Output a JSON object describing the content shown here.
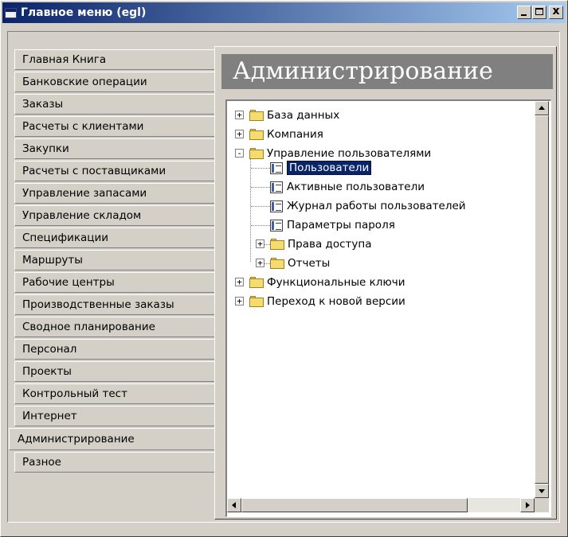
{
  "window": {
    "title": "Главное меню (egl)",
    "close_glyph": "x"
  },
  "tabs": [
    {
      "label": "Главная Книга"
    },
    {
      "label": "Банковские операции"
    },
    {
      "label": "Заказы"
    },
    {
      "label": "Расчеты с клиентами"
    },
    {
      "label": "Закупки"
    },
    {
      "label": "Расчеты с поставщиками"
    },
    {
      "label": "Управление запасами"
    },
    {
      "label": "Управление складом"
    },
    {
      "label": "Спецификации"
    },
    {
      "label": "Маршруты"
    },
    {
      "label": "Рабочие центры"
    },
    {
      "label": "Производственные заказы"
    },
    {
      "label": "Сводное планирование"
    },
    {
      "label": "Персонал"
    },
    {
      "label": "Проекты"
    },
    {
      "label": "Контрольный тест"
    },
    {
      "label": "Интернет"
    },
    {
      "label": "Администрирование",
      "active": true
    },
    {
      "label": "Разное"
    }
  ],
  "main": {
    "heading": "Администрирование"
  },
  "tree": {
    "items": [
      {
        "label": "База данных",
        "icon": "folder-icon",
        "expander": "+"
      },
      {
        "label": "Компания",
        "icon": "folder-icon",
        "expander": "+"
      },
      {
        "label": "Управление пользователями",
        "icon": "folder-icon",
        "expander": "-"
      },
      {
        "label": "Пользователи",
        "icon": "form-icon",
        "selected": true
      },
      {
        "label": "Активные пользователи",
        "icon": "form-icon"
      },
      {
        "label": "Журнал работы пользователей",
        "icon": "form-icon"
      },
      {
        "label": "Параметры пароля",
        "icon": "form-icon"
      },
      {
        "label": "Права доступа",
        "icon": "folder-icon",
        "expander": "+"
      },
      {
        "label": "Отчеты",
        "icon": "folder-icon",
        "expander": "+"
      },
      {
        "label": "Функциональные ключи",
        "icon": "folder-icon",
        "expander": "+"
      },
      {
        "label": "Переход к новой версии",
        "icon": "folder-icon",
        "expander": "+"
      }
    ]
  },
  "colors": {
    "titlebar_start": "#0a246a",
    "titlebar_end": "#a6caf0",
    "heading_bg": "#808080",
    "face": "#d4d0c8"
  }
}
